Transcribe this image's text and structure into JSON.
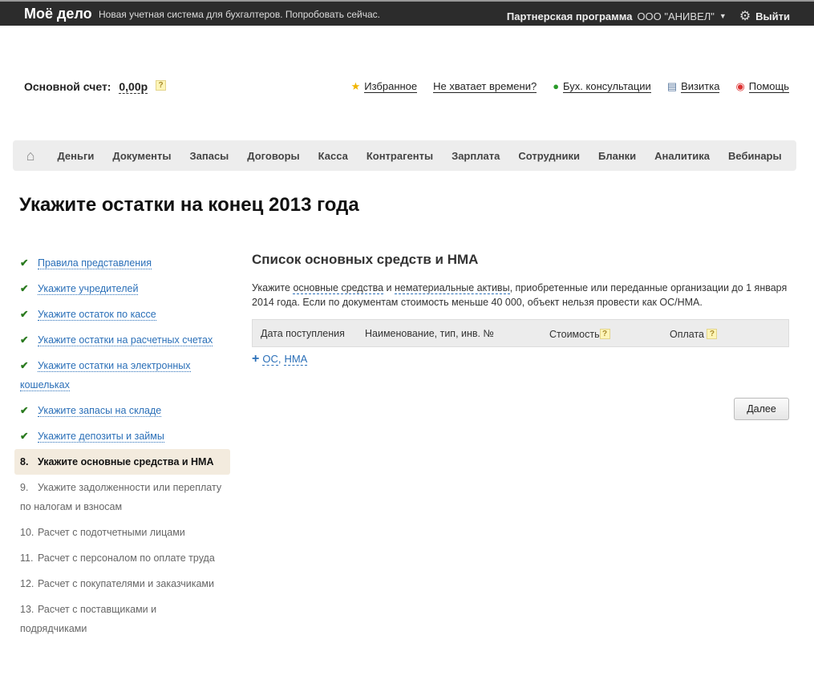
{
  "topbar": {
    "logo": "Моё дело",
    "promo": "Новая учетная система для бухгалтеров. Попробовать сейчас.",
    "partner": "Партнерская программа",
    "company": "ООО \"АНИВЕЛ\"",
    "logout": "Выйти"
  },
  "account": {
    "label": "Основной счет:",
    "value": "0,00р",
    "help": "?"
  },
  "links": [
    {
      "label": "Избранное",
      "icon": "star-icon"
    },
    {
      "label": "Не хватает времени?"
    },
    {
      "label": "Бух. консультации",
      "icon": "chat-icon"
    },
    {
      "label": "Визитка",
      "icon": "card-icon"
    },
    {
      "label": "Помощь",
      "icon": "lifebuoy-icon"
    }
  ],
  "nav": [
    "Деньги",
    "Документы",
    "Запасы",
    "Договоры",
    "Касса",
    "Контрагенты",
    "Зарплата",
    "Сотрудники",
    "Бланки",
    "Аналитика",
    "Вебинары"
  ],
  "title": "Укажите остатки на конец 2013 года",
  "steps": [
    {
      "label": "Правила представления",
      "status": "done"
    },
    {
      "label": "Укажите учредителей",
      "status": "done"
    },
    {
      "label": "Укажите остаток по кассе",
      "status": "done"
    },
    {
      "label": "Укажите остатки на расчетных счетах",
      "status": "done"
    },
    {
      "label": "Укажите остатки на электронных кошельках",
      "status": "done"
    },
    {
      "label": "Укажите запасы на складе",
      "status": "done"
    },
    {
      "label": "Укажите депозиты и займы",
      "status": "done"
    },
    {
      "num": "8.",
      "label": "Укажите основные средства и НМА",
      "status": "active"
    },
    {
      "num": "9.",
      "label": "Укажите задолженности или переплату по налогам и взносам",
      "status": "todo"
    },
    {
      "num": "10.",
      "label": "Расчет с подотчетными лицами",
      "status": "todo"
    },
    {
      "num": "11.",
      "label": "Расчет с персоналом по оплате труда",
      "status": "todo"
    },
    {
      "num": "12.",
      "label": "Расчет с покупателями и заказчиками",
      "status": "todo"
    },
    {
      "num": "13.",
      "label": "Расчет с поставщиками и подрядчиками",
      "status": "todo"
    }
  ],
  "main": {
    "heading": "Список основных средств и НМА",
    "desc1": "Укажите ",
    "desc_link1": "основные средства",
    "desc2": " и ",
    "desc_link2": "нематериальные активы",
    "desc3": ", приобретенные или переданные организации до 1 января 2014 года. Если по документам стоимость меньше 40 000, объект нельзя провести как ОС/НМА.",
    "columns": [
      "Дата поступления",
      "Наименование, тип, инв. №",
      "Стоимость",
      "Оплата"
    ],
    "add_plus": "+",
    "add_os": "ОС",
    "add_sep": ",",
    "add_nma": "НМА",
    "next": "Далее"
  }
}
